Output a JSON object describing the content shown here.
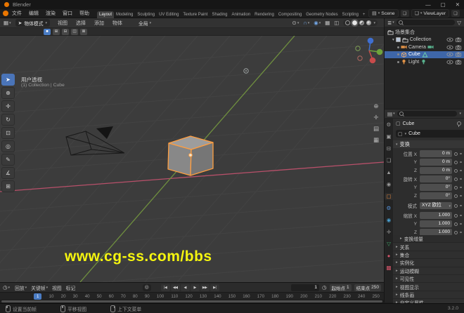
{
  "window": {
    "title": "Blender",
    "min": "—",
    "max": "▢",
    "close": "✕"
  },
  "topbar": {
    "menus": [
      "文件",
      "编辑",
      "渲染",
      "窗口",
      "帮助"
    ],
    "tabs": [
      {
        "label": "Layout",
        "active": true
      },
      {
        "label": "Modeling"
      },
      {
        "label": "Sculpting"
      },
      {
        "label": "UV Editing"
      },
      {
        "label": "Texture Paint"
      },
      {
        "label": "Shading"
      },
      {
        "label": "Animation"
      },
      {
        "label": "Rendering"
      },
      {
        "label": "Compositing"
      },
      {
        "label": "Geometry Nodes"
      },
      {
        "label": "Scripting"
      },
      {
        "label": "+"
      }
    ],
    "scene_label": "Scene",
    "view_layer_label": "ViewLayer"
  },
  "viewport_header": {
    "mode": "物体模式",
    "menus": [
      "视图",
      "选择",
      "添加",
      "物体"
    ],
    "orientation": "全局"
  },
  "tool_settings": {
    "modes": [
      {
        "name": "select-mode-set",
        "glyph": "■",
        "active": true
      },
      {
        "name": "select-mode-extend",
        "glyph": "⊞"
      },
      {
        "name": "select-mode-subtract",
        "glyph": "⊟"
      },
      {
        "name": "select-mode-invert",
        "glyph": "◫"
      },
      {
        "name": "select-mode-intersect",
        "glyph": "⊠"
      }
    ]
  },
  "toolbar": {
    "tools": [
      {
        "name": "tool-select-box",
        "glyph": "➤",
        "active": true
      },
      {
        "name": "tool-cursor",
        "glyph": "⊕"
      },
      {
        "name": "tool-move",
        "glyph": "✛"
      },
      {
        "name": "tool-rotate",
        "glyph": "↻"
      },
      {
        "name": "tool-scale",
        "glyph": "⊡"
      },
      {
        "name": "tool-transform",
        "glyph": "◎"
      },
      {
        "name": "tool-annotate",
        "glyph": "✎"
      },
      {
        "name": "tool-measure",
        "glyph": "∡"
      },
      {
        "name": "tool-add-cube",
        "glyph": "⊞"
      }
    ]
  },
  "viewport": {
    "view_label": "用户透视",
    "context_label": "(1) Collection | Cube",
    "watermark": "www.cg-ss.com/bbs"
  },
  "outliner": {
    "rows": [
      {
        "label": "场景集合",
        "icon": "i-collection",
        "icon_name": "scene-collection-icon",
        "icon_color": "#cfcfcf",
        "indent": 0,
        "toggles": []
      },
      {
        "label": "Collection",
        "icon": "i-collection",
        "icon_name": "collection-icon",
        "icon_color": "#cfcfcf",
        "indent": 1,
        "expanded": true,
        "checkbox": true,
        "toggles": [
          "eye",
          "photo"
        ]
      },
      {
        "label": "Camera",
        "icon": "i-cam",
        "icon_name": "camera-object-icon",
        "icon_color": "#de9046",
        "data_icon": "i-cam",
        "data_icon_name": "camera-data-icon",
        "data_color": "#58b08c",
        "indent": 2,
        "toggles": [
          "eye",
          "photo"
        ]
      },
      {
        "label": "Cube",
        "icon": "i-cube",
        "icon_name": "cube-object-icon",
        "icon_color": "#f0b070",
        "data_icon": "i-tri",
        "data_icon_name": "mesh-data-icon",
        "data_color": "#6fd0a8",
        "indent": 2,
        "selected": true,
        "toggles": [
          "eye",
          "photo"
        ]
      },
      {
        "label": "Light",
        "icon": "i-bulb",
        "icon_name": "light-object-icon",
        "icon_color": "#de9046",
        "data_icon": "i-bulb",
        "data_icon_name": "light-data-icon",
        "data_color": "#58b08c",
        "indent": 2,
        "toggles": [
          "eye",
          "photo"
        ]
      }
    ]
  },
  "properties": {
    "breadcrumb": "Cube",
    "name_value": "Cube",
    "tabs": [
      {
        "name": "tab-tool",
        "glyph": "⚙",
        "color": "#9b9b9b"
      },
      {
        "name": "tab-render",
        "glyph": "▣",
        "color": "#9b9b9b"
      },
      {
        "name": "tab-output",
        "glyph": "⊟",
        "color": "#9b9b9b"
      },
      {
        "name": "tab-view-layer",
        "glyph": "❏",
        "color": "#9b9b9b"
      },
      {
        "name": "tab-scene",
        "glyph": "▲",
        "color": "#9b9b9b"
      },
      {
        "name": "tab-world",
        "glyph": "◉",
        "color": "#9b9b9b"
      },
      {
        "name": "tab-object",
        "glyph": "▢",
        "color": "#e8883c",
        "active": true
      },
      {
        "name": "tab-modifiers",
        "glyph": "⚙",
        "color": "#5796e0"
      },
      {
        "name": "tab-physics",
        "glyph": "◉",
        "color": "#4aa3d4"
      },
      {
        "name": "tab-constraints",
        "glyph": "✛",
        "color": "#9b9b9b"
      },
      {
        "name": "tab-object-data",
        "glyph": "▽",
        "color": "#3fa66b"
      },
      {
        "name": "tab-material",
        "glyph": "●",
        "color": "#d4556a"
      },
      {
        "name": "tab-texture",
        "glyph": "▩",
        "color": "#d4556a"
      }
    ],
    "transform": {
      "title": "变换",
      "rows": [
        {
          "label": "位置 X",
          "value": "0 m"
        },
        {
          "label": "Y",
          "value": "0 m"
        },
        {
          "label": "Z",
          "value": "0 m"
        },
        {
          "label": "旋转 X",
          "value": "0°"
        },
        {
          "label": "Y",
          "value": "0°"
        },
        {
          "label": "Z",
          "value": "0°"
        },
        {
          "label": "模式",
          "value": "XYZ 欧拉",
          "dropdown": true
        },
        {
          "label": "缩放 X",
          "value": "1.000"
        },
        {
          "label": "Y",
          "value": "1.000"
        },
        {
          "label": "Z",
          "value": "1.000"
        }
      ]
    },
    "sections": [
      "变换增量",
      "关系",
      "集合",
      "实例化",
      "运动模糊",
      "可见性",
      "视图显示",
      "线条画",
      "自定义属性"
    ]
  },
  "timeline": {
    "menus": [
      {
        "label": "回放",
        "dropdown": true
      },
      {
        "label": "关键帧",
        "dropdown": true
      },
      {
        "label": "视图"
      },
      {
        "label": "标记"
      }
    ],
    "transport": [
      {
        "name": "jump-to-start-button",
        "glyph": "|◀"
      },
      {
        "name": "previous-keyframe-button",
        "glyph": "◀◀"
      },
      {
        "name": "play-reverse-button",
        "glyph": "◀"
      },
      {
        "name": "play-button",
        "glyph": "▶"
      },
      {
        "name": "next-keyframe-button",
        "glyph": "▶▶"
      },
      {
        "name": "jump-to-end-button",
        "glyph": "▶|"
      }
    ],
    "current_frame": "1",
    "start_label": "起始点",
    "start_value": "1",
    "end_label": "结束点",
    "end_value": "250",
    "ruler": [
      "1",
      "10",
      "20",
      "30",
      "40",
      "50",
      "60",
      "70",
      "80",
      "90",
      "100",
      "110",
      "120",
      "130",
      "140",
      "150",
      "160",
      "170",
      "180",
      "190",
      "200",
      "210",
      "220",
      "230",
      "240",
      "250"
    ]
  },
  "statusbar": {
    "hints": [
      {
        "button": "left",
        "label": "设置当前帧"
      },
      {
        "button": "middle",
        "label": "平移视图"
      },
      {
        "button": "right",
        "label": "上下文菜单"
      }
    ],
    "version": "3.2.0"
  },
  "colors": {
    "accent": "#4772b3",
    "selection": "#3e66a8",
    "cube_outline": "#ff9e40",
    "axis_x": "#b8506a",
    "axis_y": "#6f8f3f",
    "watermark": "#f5f50f",
    "object_icon": "#de9046",
    "data_icon": "#58b08c",
    "logo": "#ea7600"
  },
  "icons": {
    "dropdown": "▾",
    "filter": "▽",
    "pivot": "⊙",
    "magnet": "∩",
    "proportional": "◉",
    "gizmos": "▦",
    "overlays": "◫",
    "editor_3d": "▦",
    "editor_outliner": "≣",
    "editor_props": "▤",
    "editor_timeline": "◷",
    "autokey": "◎",
    "zoom": "⊕",
    "pan": "✛",
    "camera_view": "▤",
    "ortho_grid": "▦",
    "mode_cursor": "➤",
    "scene": "▤",
    "view_layer": "❏",
    "new_copy": "❏",
    "object": "▢",
    "preview_range": "◷"
  }
}
